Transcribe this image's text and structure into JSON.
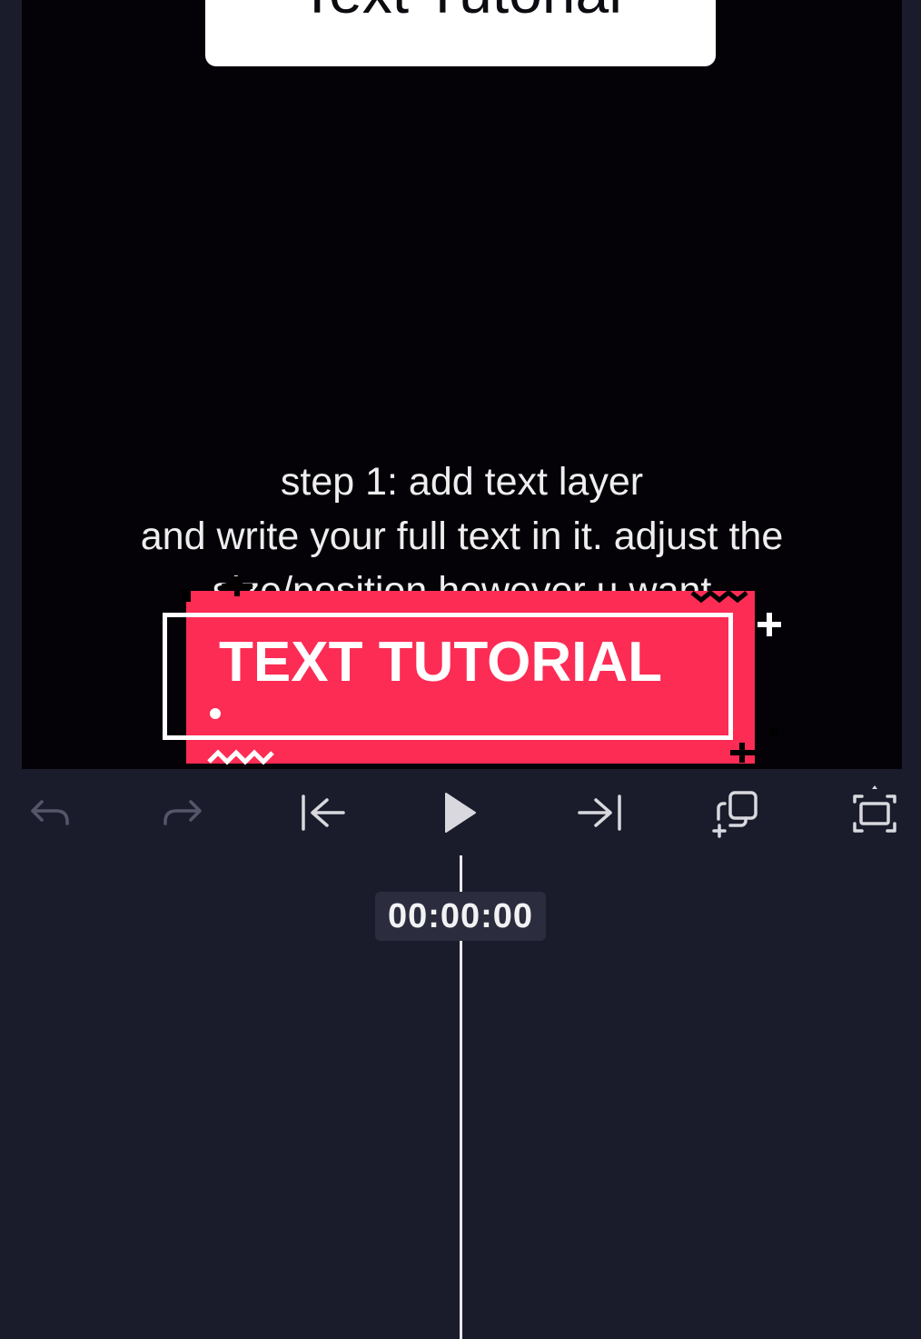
{
  "preview": {
    "title_card_text": "Text Tutorial",
    "caption_lines": [
      "step 1: add text layer",
      "and write your full text in it. adjust the",
      "size/position however u want"
    ],
    "sticker_text": "TEXT TUTORIAL"
  },
  "toolbar": {
    "buttons": [
      {
        "name": "undo",
        "icon": "undo-arrow-icon",
        "enabled": false
      },
      {
        "name": "redo",
        "icon": "redo-arrow-icon",
        "enabled": false
      },
      {
        "name": "jump-to-start",
        "icon": "skip-to-start-icon",
        "enabled": true
      },
      {
        "name": "play",
        "icon": "play-icon",
        "enabled": true
      },
      {
        "name": "jump-to-end",
        "icon": "skip-to-end-icon",
        "enabled": true
      },
      {
        "name": "keyframe",
        "icon": "keyframe-add-icon",
        "enabled": true
      },
      {
        "name": "fullscreen",
        "icon": "fullscreen-icon",
        "enabled": true
      }
    ]
  },
  "timeline": {
    "timecode": "00:00:00"
  },
  "colors": {
    "background": "#1b1c2b",
    "preview_background": "#040207",
    "sticker_pink": "#fc2c54",
    "icon_enabled": "#d8d8de",
    "icon_disabled": "#55566a"
  }
}
